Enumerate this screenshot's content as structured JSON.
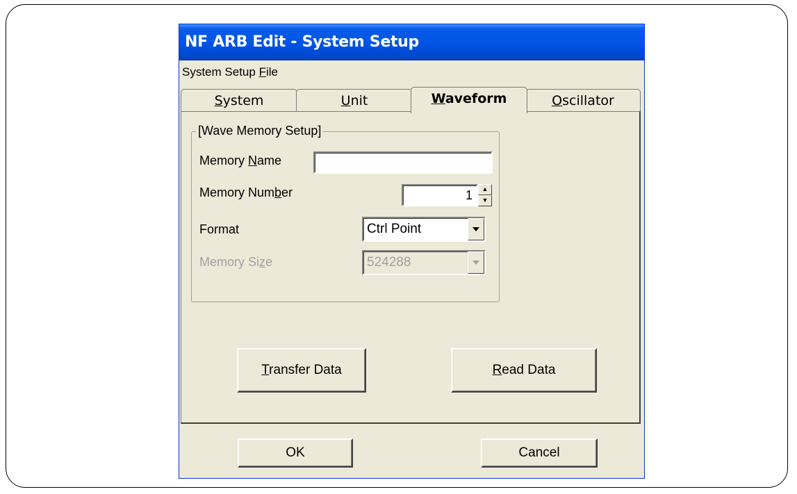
{
  "window": {
    "title": "NF ARB Edit - System Setup",
    "menu": {
      "prefix": "System Setup ",
      "underline": "F",
      "suffix": "ile"
    }
  },
  "tabs": [
    {
      "underline": "S",
      "rest": "ystem",
      "active": false
    },
    {
      "underline": "U",
      "rest": "nit",
      "active": false
    },
    {
      "underline": "W",
      "rest": "aveform",
      "active": true
    },
    {
      "underline": "O",
      "rest": "scillator",
      "active": false
    }
  ],
  "group": {
    "title": "[Wave Memory Setup]",
    "memory_name": {
      "pre": "Memory ",
      "u": "N",
      "post": "ame",
      "value": ""
    },
    "memory_number": {
      "pre": "Memory Num",
      "u": "b",
      "post": "er",
      "value": "1"
    },
    "format": {
      "label": "Format",
      "value": "Ctrl Point"
    },
    "memory_size": {
      "pre": "Memory Si",
      "u": "z",
      "post": "e",
      "value": "524288"
    }
  },
  "buttons": {
    "transfer": {
      "u": "T",
      "rest": "ransfer Data"
    },
    "read": {
      "u": "R",
      "rest": "ead Data"
    },
    "ok": "OK",
    "cancel": "Cancel"
  }
}
